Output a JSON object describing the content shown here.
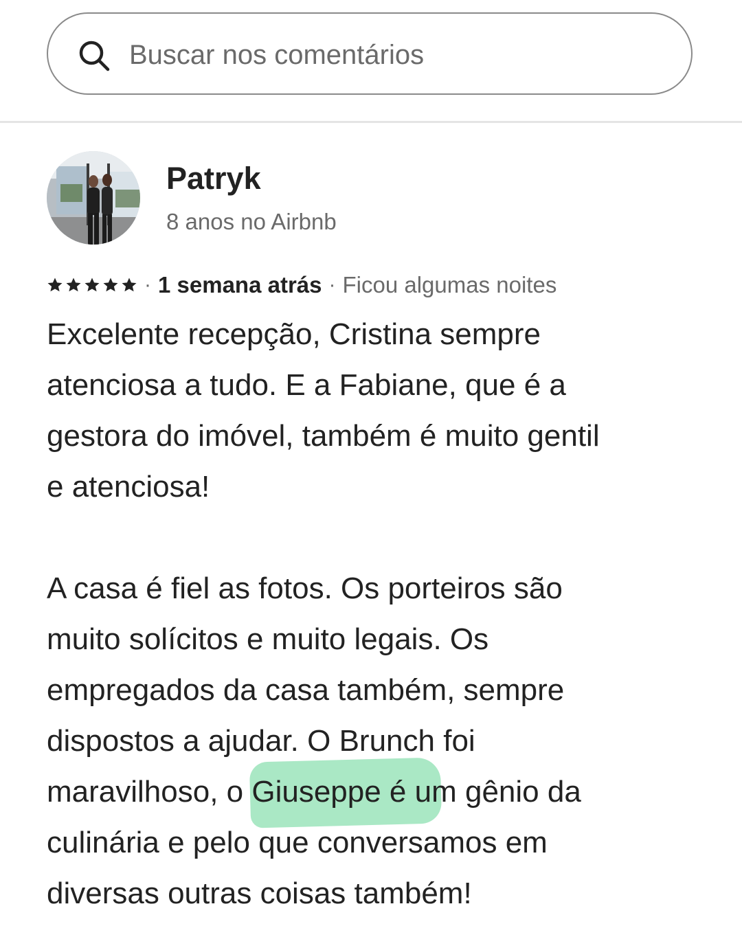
{
  "search": {
    "placeholder": "Buscar nos comentários"
  },
  "review": {
    "reviewer_name": "Patryk",
    "reviewer_meta": "8 anos no Airbnb",
    "rating": 5,
    "separator": "·",
    "date": "1 semana atrás",
    "stay_length": "Ficou algumas noites",
    "paragraphs": [
      [
        "Excelente recepção, Cristina sempre",
        "atenciosa a tudo. E a Fabiane, que é a",
        "gestora do imóvel, também é muito gentil",
        "e atenciosa!"
      ],
      [
        "A casa é fiel as fotos. Os porteiros são",
        "muito solícitos e muito legais. Os",
        "empregados da casa também, sempre",
        "dispostos a ajudar. O Brunch foi",
        "maravilhoso, o Giuseppe é um gênio da",
        "culinária e pelo que conversamos em",
        "diversas outras coisas também!"
      ]
    ],
    "highlighted_text": "o Giuseppe é",
    "highlight_color": "#8ee0b2"
  },
  "icons": {
    "search": "search-icon",
    "star": "star-icon",
    "avatar": "avatar"
  },
  "colors": {
    "text_primary": "#222222",
    "text_secondary": "#6a6a6a",
    "border": "#8a8a8a",
    "divider": "#e4e4e4"
  }
}
